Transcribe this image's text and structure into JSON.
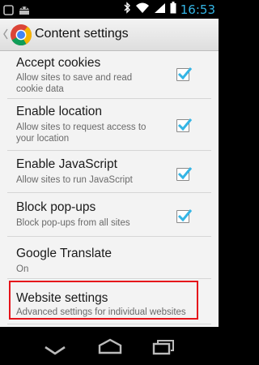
{
  "status_bar": {
    "time": "16:53"
  },
  "action_bar": {
    "title": "Content settings"
  },
  "settings": [
    {
      "title": "Accept cookies",
      "summary": [
        "Allow sites to save and read",
        "cookie data"
      ],
      "checked": true
    },
    {
      "title": "Enable location",
      "summary": [
        "Allow sites to request access to",
        "your location"
      ],
      "checked": true
    },
    {
      "title": "Enable JavaScript",
      "summary": [
        "Allow sites to run JavaScript"
      ],
      "checked": true
    },
    {
      "title": "Block pop-ups",
      "summary": [
        "Block pop-ups from all sites"
      ],
      "checked": true
    },
    {
      "title": "Google Translate",
      "summary": [
        "On"
      ],
      "checked": null
    },
    {
      "title": "Website settings",
      "summary": [
        "Advanced settings for individual websites"
      ],
      "checked": null
    }
  ],
  "icons": {
    "status_left": [
      "notification-square-icon",
      "android-robot-icon"
    ],
    "status_right": [
      "bluetooth-icon",
      "wifi-icon",
      "signal-icon",
      "battery-icon"
    ],
    "nav": [
      "back-icon",
      "home-icon",
      "recent-apps-icon"
    ]
  },
  "colors": {
    "accent": "#34b5e5",
    "highlight_border": "#e5141b"
  }
}
